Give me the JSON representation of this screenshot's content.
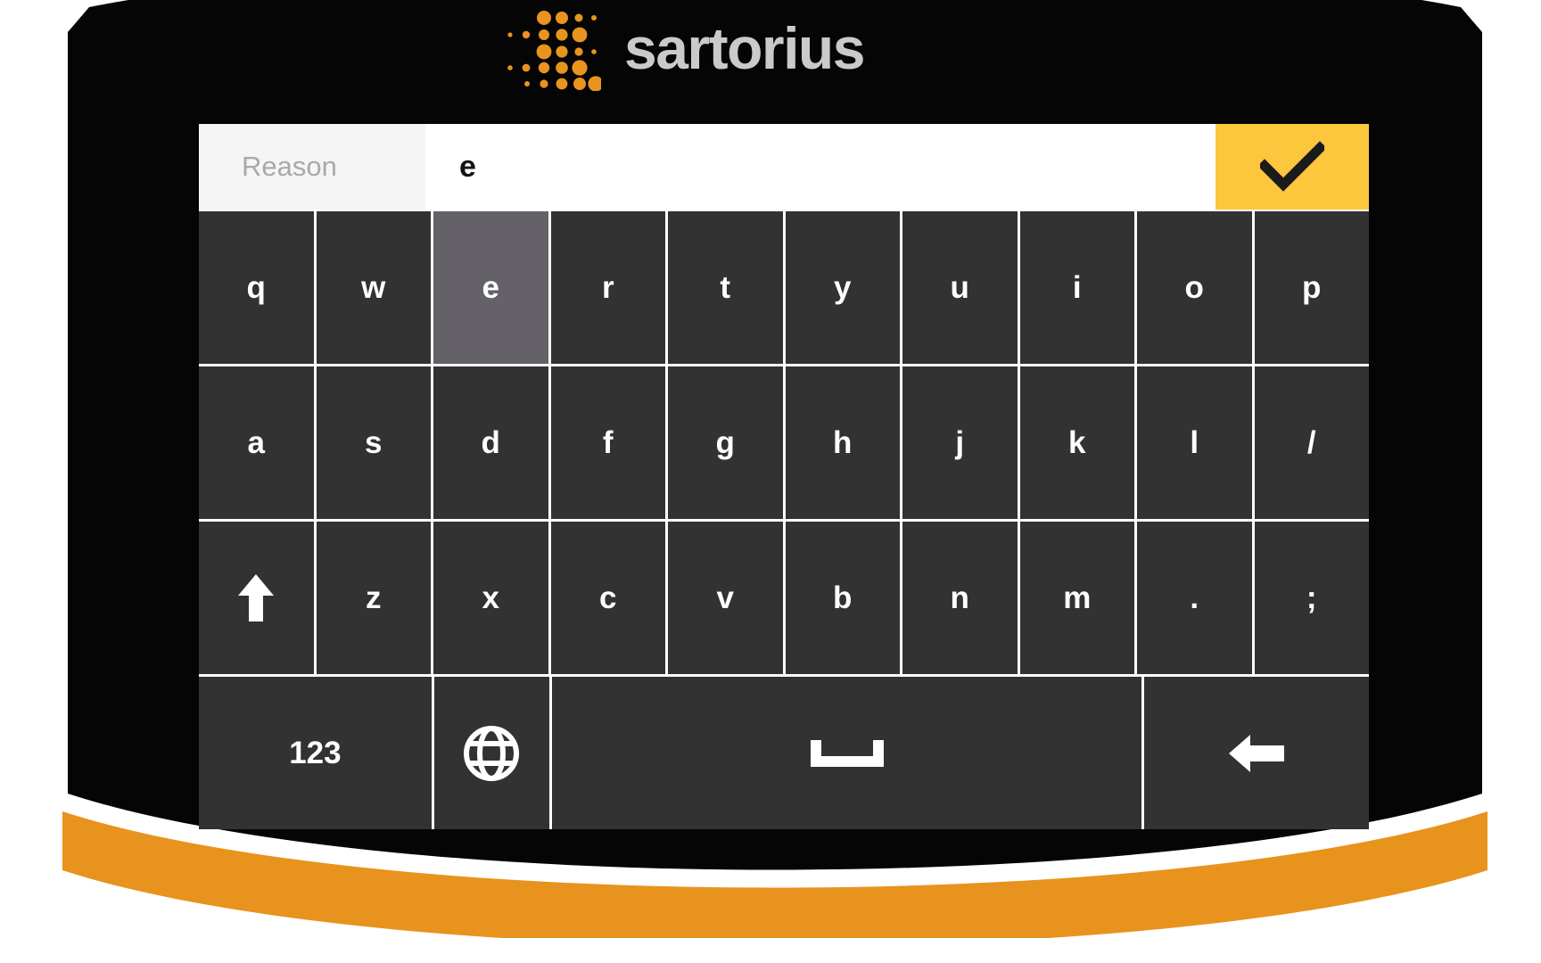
{
  "brand": {
    "name": "sartorius",
    "logo_icon": "sartorius-dot-matrix-logo",
    "word_color": "#c9cacb",
    "dot_color": "#e8941f"
  },
  "input_bar": {
    "label": "Reason",
    "value": "e",
    "placeholder": "",
    "confirm_icon": "checkmark-icon",
    "confirm_color": "#fcc63d"
  },
  "keyboard": {
    "active_key": "e",
    "key_bg": "#323232",
    "active_key_bg": "#646168",
    "rows": [
      {
        "keys": [
          {
            "label": "q",
            "name": "key-q",
            "type": "char"
          },
          {
            "label": "w",
            "name": "key-w",
            "type": "char"
          },
          {
            "label": "e",
            "name": "key-e",
            "type": "char",
            "active": true
          },
          {
            "label": "r",
            "name": "key-r",
            "type": "char"
          },
          {
            "label": "t",
            "name": "key-t",
            "type": "char"
          },
          {
            "label": "y",
            "name": "key-y",
            "type": "char"
          },
          {
            "label": "u",
            "name": "key-u",
            "type": "char"
          },
          {
            "label": "i",
            "name": "key-i",
            "type": "char"
          },
          {
            "label": "o",
            "name": "key-o",
            "type": "char"
          },
          {
            "label": "p",
            "name": "key-p",
            "type": "char"
          }
        ]
      },
      {
        "keys": [
          {
            "label": "a",
            "name": "key-a",
            "type": "char"
          },
          {
            "label": "s",
            "name": "key-s",
            "type": "char"
          },
          {
            "label": "d",
            "name": "key-d",
            "type": "char"
          },
          {
            "label": "f",
            "name": "key-f",
            "type": "char"
          },
          {
            "label": "g",
            "name": "key-g",
            "type": "char"
          },
          {
            "label": "h",
            "name": "key-h",
            "type": "char"
          },
          {
            "label": "j",
            "name": "key-j",
            "type": "char"
          },
          {
            "label": "k",
            "name": "key-k",
            "type": "char"
          },
          {
            "label": "l",
            "name": "key-l",
            "type": "char"
          },
          {
            "label": "/",
            "name": "key-slash",
            "type": "char"
          }
        ]
      },
      {
        "keys": [
          {
            "label": "",
            "name": "key-shift",
            "type": "icon",
            "icon": "arrow-up-icon"
          },
          {
            "label": "z",
            "name": "key-z",
            "type": "char"
          },
          {
            "label": "x",
            "name": "key-x",
            "type": "char"
          },
          {
            "label": "c",
            "name": "key-c",
            "type": "char"
          },
          {
            "label": "v",
            "name": "key-v",
            "type": "char"
          },
          {
            "label": "b",
            "name": "key-b",
            "type": "char"
          },
          {
            "label": "n",
            "name": "key-n",
            "type": "char"
          },
          {
            "label": "m",
            "name": "key-m",
            "type": "char"
          },
          {
            "label": ".",
            "name": "key-period",
            "type": "char"
          },
          {
            "label": ";",
            "name": "key-semicolon",
            "type": "char"
          }
        ]
      },
      {
        "keys": [
          {
            "label": "123",
            "name": "key-numeric-mode",
            "type": "char"
          },
          {
            "label": "",
            "name": "key-language-globe",
            "type": "icon",
            "icon": "globe-icon"
          },
          {
            "label": "",
            "name": "key-space",
            "type": "icon",
            "icon": "spacebar-icon"
          },
          {
            "label": "",
            "name": "key-backspace",
            "type": "icon",
            "icon": "arrow-left-icon"
          }
        ]
      }
    ]
  },
  "device": {
    "bezel_color": "#050505",
    "accent_stripe_color": "#e8931d"
  }
}
